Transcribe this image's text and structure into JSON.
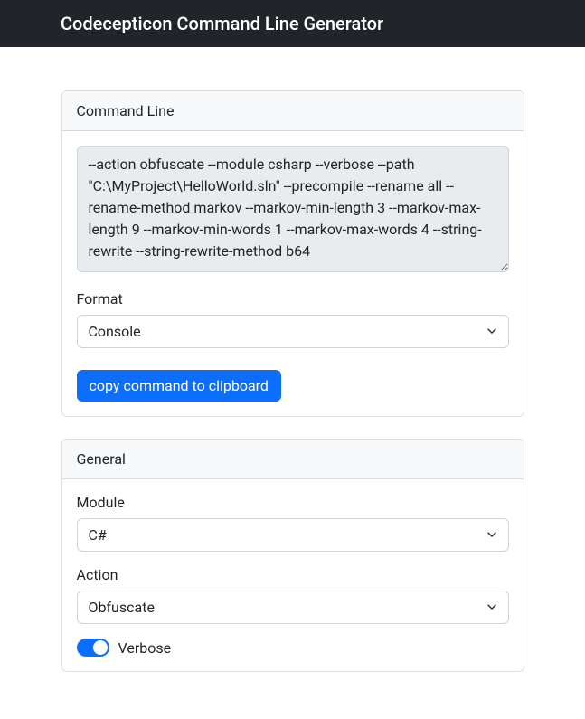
{
  "header": {
    "title": "Codecepticon Command Line Generator"
  },
  "commandLine": {
    "cardTitle": "Command Line",
    "textareaValue": "--action obfuscate --module csharp --verbose --path \"C:\\MyProject\\HelloWorld.sln\" --precompile --rename all --rename-method markov --markov-min-length 3 --markov-max-length 9 --markov-min-words 1 --markov-max-words 4 --string-rewrite --string-rewrite-method b64",
    "formatLabel": "Format",
    "formatValue": "Console",
    "copyButton": "copy command to clipboard"
  },
  "general": {
    "cardTitle": "General",
    "moduleLabel": "Module",
    "moduleValue": "C#",
    "actionLabel": "Action",
    "actionValue": "Obfuscate",
    "verboseLabel": "Verbose"
  }
}
